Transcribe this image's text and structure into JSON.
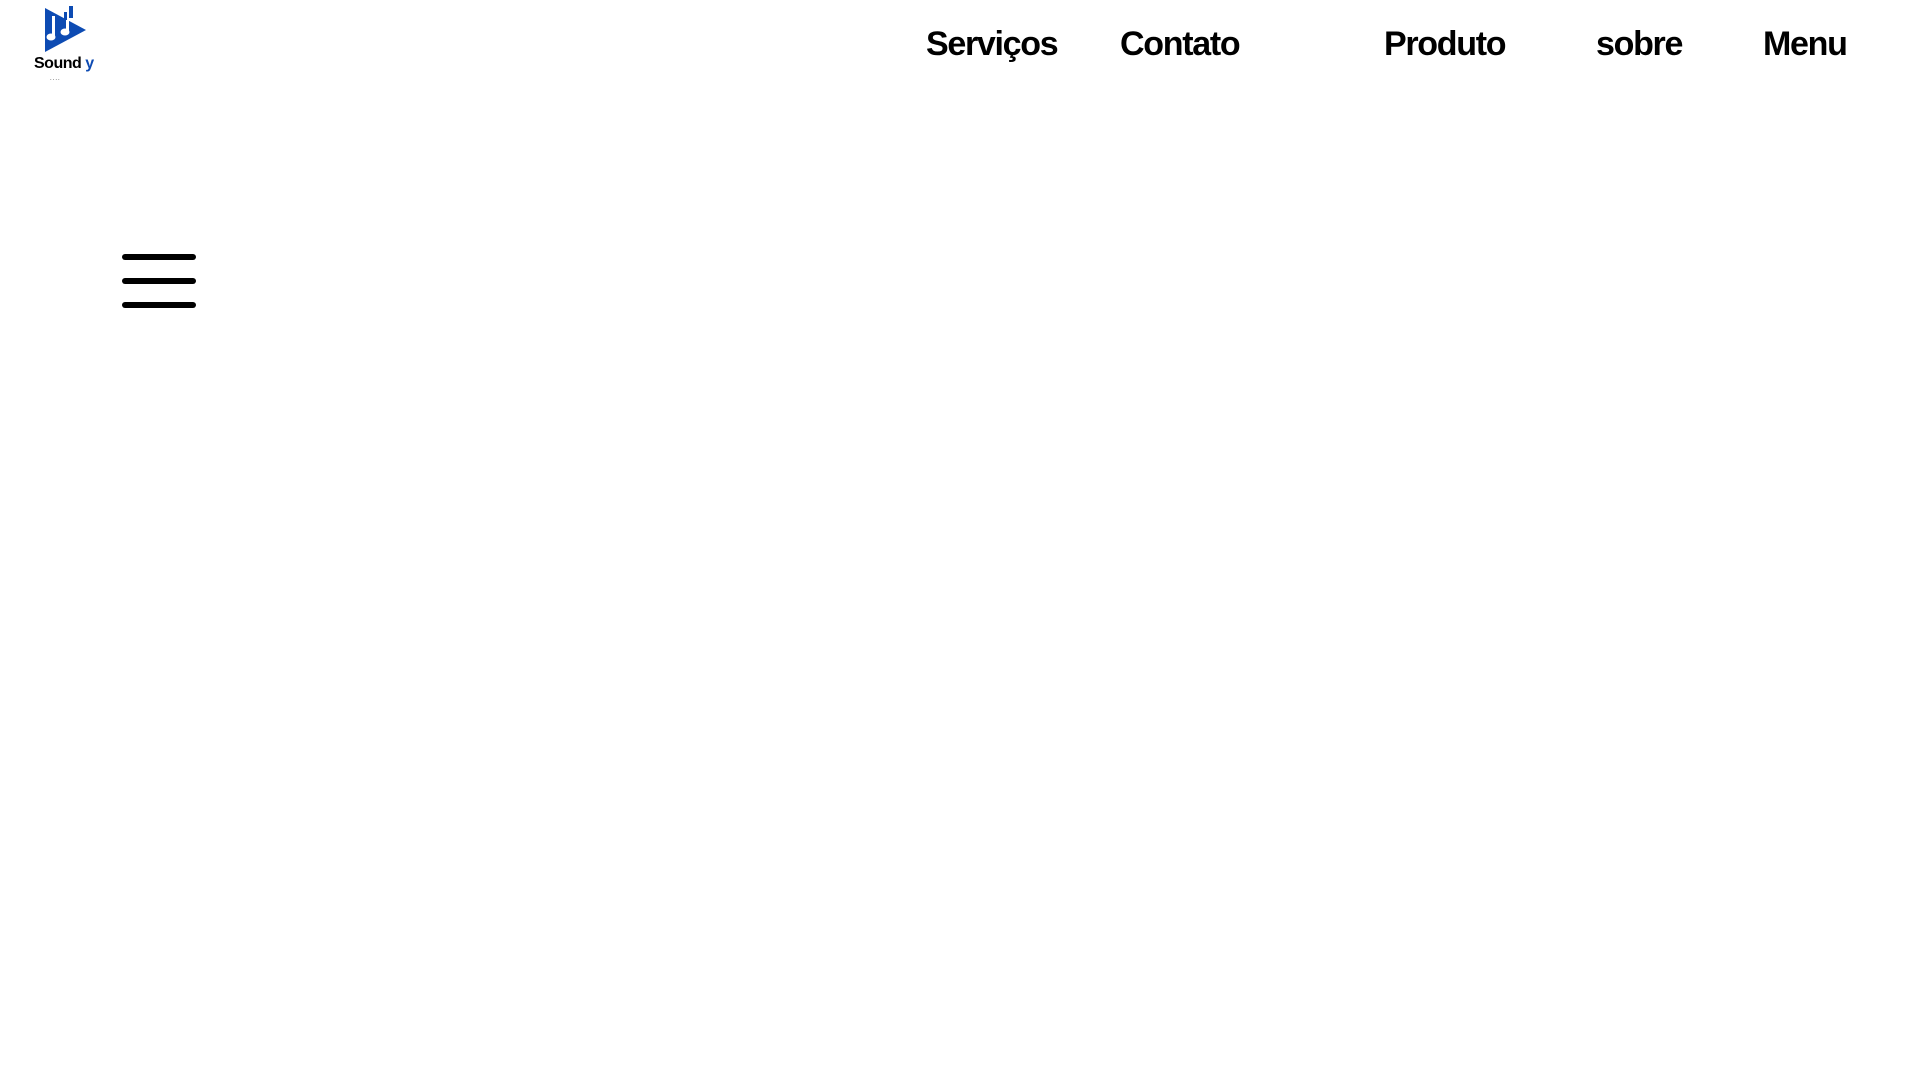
{
  "logo": {
    "word_main": "Sound",
    "word_accent": "y",
    "tagline": "....",
    "icon": "music-notes-play-icon",
    "brand_color": "#0d4bb3"
  },
  "nav": {
    "items": [
      {
        "label": "Serviços"
      },
      {
        "label": "Contato"
      },
      {
        "label": "Produto"
      },
      {
        "label": "sobre"
      },
      {
        "label": "Menu"
      }
    ]
  },
  "hamburger": {
    "icon": "hamburger-menu-icon"
  }
}
